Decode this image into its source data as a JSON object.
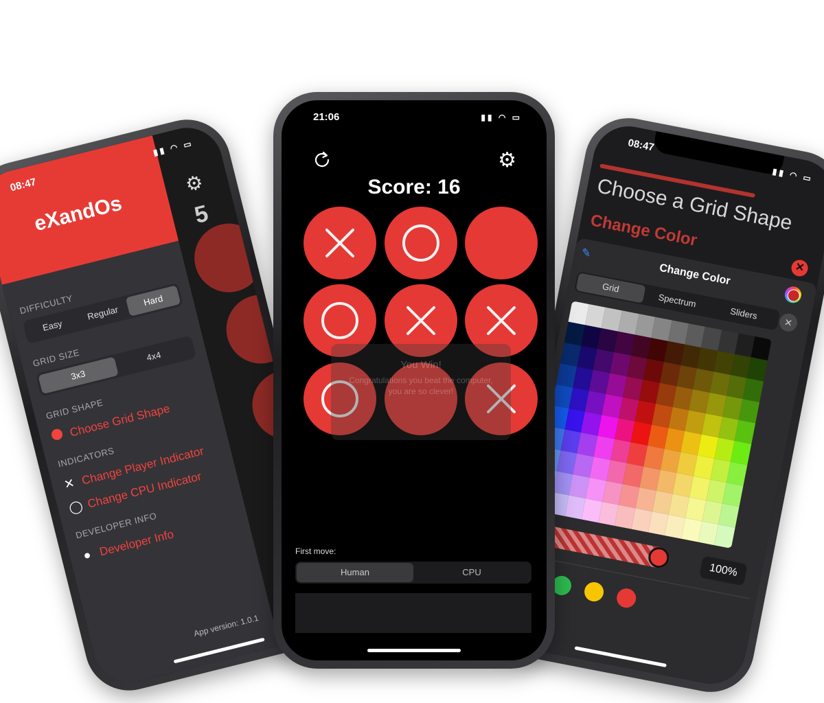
{
  "left_phone": {
    "status_time": "08:47",
    "app_name": "eXandOs",
    "background_score": "5",
    "sections": {
      "difficulty": "DIFFICULTY",
      "grid_size": "GRID SIZE",
      "grid_shape": "GRID SHAPE",
      "indicators": "INDICATORS",
      "developer_info": "DEVELOPER INFO"
    },
    "difficulty_options": [
      "Easy",
      "Regular",
      "Hard"
    ],
    "difficulty_selected": "Hard",
    "grid_size_options": [
      "3x3",
      "4x4"
    ],
    "grid_size_selected": "3x3",
    "menu": {
      "choose_grid_shape": "Choose Grid Shape",
      "change_player_indicator": "Change Player Indicator",
      "change_cpu_indicator": "Change CPU Indicator",
      "developer_info": "Developer Info"
    },
    "app_version_label": "App version:",
    "app_version": "1.0.1"
  },
  "center_phone": {
    "status_time": "21:06",
    "score_text": "Score: 16",
    "board": [
      "X",
      "O",
      "",
      "O",
      "X",
      "X",
      "O",
      "",
      "X"
    ],
    "overlay_title": "You Win!",
    "overlay_text": "Congratulations you beat the computer, you are so clever!",
    "first_move_label": "First move:",
    "first_move_options": [
      "Human",
      "CPU"
    ],
    "first_move_selected": "Human",
    "accent_color": "#e53935"
  },
  "right_phone": {
    "status_time": "08:47",
    "heading": "Choose a Grid Shape",
    "change_color_large": "Change Color",
    "sheet_title": "Change Color",
    "tabs": [
      "Grid",
      "Spectrum",
      "Sliders"
    ],
    "tab_selected": "Grid",
    "opacity": "100%",
    "swatch_colors": [
      "#0a60ff",
      "#2dbb4e",
      "#f7c600",
      "#e53935"
    ]
  }
}
